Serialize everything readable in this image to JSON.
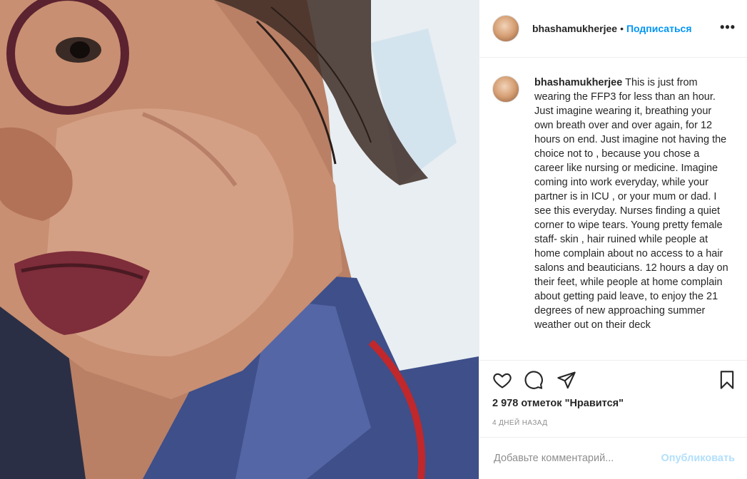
{
  "post": {
    "photo_icon": "post-photo",
    "username": "bhashamukherjee",
    "separator": "•",
    "follow_label": "Подписаться",
    "more_label": "•••",
    "caption_username": "bhashamukherjee",
    "caption_text": "This is just from wearing the FFP3 for less than an hour. Just imagine wearing it, breathing your own breath over and over again, for 12 hours on end. Just imagine not having the choice not to , because you chose a career like nursing or medicine. Imagine coming into work everyday, while your partner is in ICU , or your mum or dad. I see this everyday. Nurses finding a quiet corner to wipe tears. Young pretty female staff- skin , hair ruined while people at home complain about no access to a hair salons and beauticians. 12 hours a day on their feet, while people at home complain about getting paid leave, to enjoy the 21 degrees of new approaching summer weather out on their deck",
    "likes": "2 978 отметок \"Нравится\"",
    "time": "4 дней назад",
    "comment_placeholder": "Добавьте комментарий...",
    "publish_label": "Опубликовать"
  },
  "colors": {
    "accent": "#0095f6",
    "publish_disabled": "#b2dffc",
    "secondary_text": "#8e8e8e"
  }
}
